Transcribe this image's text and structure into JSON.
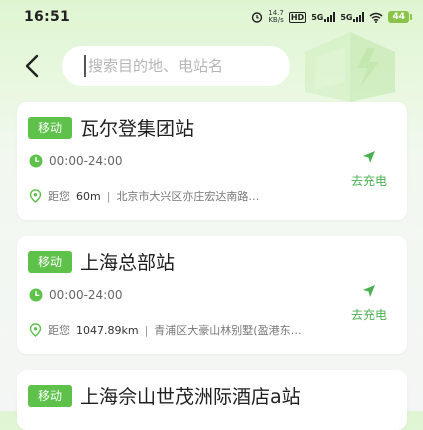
{
  "status_bar": {
    "time": "16:51",
    "speed_value": "14.7",
    "speed_unit": "KB/s",
    "hd_badge": "HD",
    "network1": "5G",
    "network2": "5G",
    "battery": "44"
  },
  "search": {
    "placeholder": "搜索目的地、电站名",
    "value": ""
  },
  "stations": [
    {
      "tag": "移动",
      "name": "瓦尔登集团站",
      "hours": "00:00-24:00",
      "distance_label": "距您",
      "distance": "60m",
      "separator": "|",
      "address": "北京市大兴区亦庄宏达南路…",
      "go_label": "去充电"
    },
    {
      "tag": "移动",
      "name": "上海总部站",
      "hours": "00:00-24:00",
      "distance_label": "距您",
      "distance": "1047.89km",
      "separator": "|",
      "address": "青浦区大豪山林别墅(盈港东…",
      "go_label": "去充电"
    },
    {
      "tag": "移动",
      "name": "上海佘山世茂洲际酒店a站"
    }
  ],
  "colors": {
    "accent_green": "#5ec14a",
    "link_green": "#4caf50",
    "battery_green": "#8bc34a"
  },
  "icons": {
    "back": "chevron-left-icon",
    "clock": "clock-icon",
    "location": "location-pin-icon",
    "navigate": "navigation-arrow-icon",
    "decoration": "charging-bolt-decoration"
  }
}
